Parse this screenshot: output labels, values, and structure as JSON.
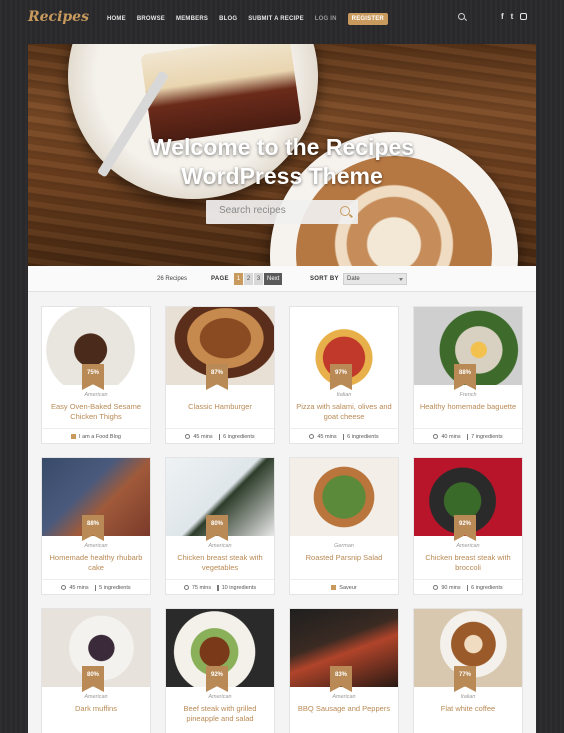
{
  "header": {
    "logo": "Recipes",
    "nav": [
      "HOME",
      "BROWSE",
      "MEMBERS",
      "BLOG",
      "SUBMIT A RECIPE"
    ],
    "login": "LOG IN",
    "register": "REGISTER",
    "social_icons": [
      "search-icon",
      "facebook-icon",
      "twitter-icon",
      "instagram-icon"
    ]
  },
  "hero": {
    "title_line1": "Welcome to the Recipes",
    "title_line2": "WordPress Theme",
    "search_placeholder": "Search recipes"
  },
  "filters": {
    "count": "26 Recipes",
    "page_label": "PAGE",
    "pages": [
      "1",
      "2",
      "3"
    ],
    "active_page": "1",
    "next": "Next",
    "sort_label": "SORT BY",
    "sort_value": "Date"
  },
  "colors": {
    "accent": "#c89a5e",
    "rating_badge": "#b98a55",
    "title_text": "#b98a55"
  },
  "recipes": [
    {
      "rating": "75%",
      "cuisine": "American",
      "title": "Easy Oven-Baked Sesame Chicken Thighs",
      "time": "",
      "ingredients": "",
      "tag": "I am a Food Blog"
    },
    {
      "rating": "87%",
      "cuisine": "",
      "title": "Classic Hamburger",
      "time": "45 mins",
      "ingredients": "6 ingredients",
      "tag": ""
    },
    {
      "rating": "97%",
      "cuisine": "Italian",
      "title": "Pizza with salami, olives and goat cheese",
      "time": "45 mins",
      "ingredients": "6 ingredients",
      "tag": ""
    },
    {
      "rating": "88%",
      "cuisine": "French",
      "title": "Healthy homemade baguette",
      "time": "40 mins",
      "ingredients": "7 ingredients",
      "tag": ""
    },
    {
      "rating": "88%",
      "cuisine": "American",
      "title": "Homemade healthy rhubarb cake",
      "time": "45 mins",
      "ingredients": "5 ingredients",
      "tag": ""
    },
    {
      "rating": "80%",
      "cuisine": "American",
      "title": "Chicken breast steak with vegetables",
      "time": "75 mins",
      "ingredients": "10 ingredients",
      "tag": ""
    },
    {
      "rating": "",
      "cuisine": "German",
      "title": "Roasted Parsnip Salad",
      "time": "",
      "ingredients": "",
      "tag": "Saveur"
    },
    {
      "rating": "92%",
      "cuisine": "American",
      "title": "Chicken breast steak with broccoli",
      "time": "90 mins",
      "ingredients": "6 ingredients",
      "tag": ""
    },
    {
      "rating": "80%",
      "cuisine": "American",
      "title": "Dark muffins",
      "time": "",
      "ingredients": "",
      "tag": ""
    },
    {
      "rating": "92%",
      "cuisine": "American",
      "title": "Beef steak with grilled pineapple and salad",
      "time": "",
      "ingredients": "",
      "tag": ""
    },
    {
      "rating": "83%",
      "cuisine": "American",
      "title": "BBQ Sausage and Peppers",
      "time": "",
      "ingredients": "",
      "tag": ""
    },
    {
      "rating": "77%",
      "cuisine": "Italian",
      "title": "Flat white coffee",
      "time": "",
      "ingredients": "",
      "tag": ""
    }
  ]
}
